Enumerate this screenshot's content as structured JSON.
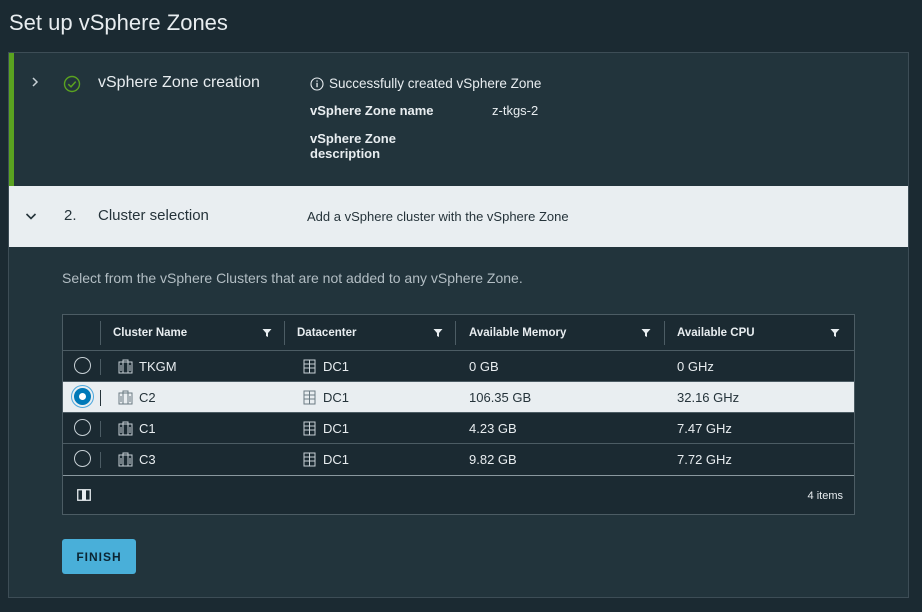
{
  "page": {
    "title": "Set up vSphere Zones"
  },
  "step1": {
    "title": "vSphere Zone creation",
    "status": "Successfully created vSphere Zone",
    "zone_name_label": "vSphere Zone name",
    "zone_name_value": "z-tkgs-2",
    "zone_desc_label_1": "vSphere Zone",
    "zone_desc_label_2": "description",
    "accent_color": "#5aa220"
  },
  "step2": {
    "number": "2.",
    "title": "Cluster selection",
    "description": "Add a vSphere cluster with the vSphere Zone",
    "instructions": "Select from the vSphere Clusters that are not added to any vSphere Zone."
  },
  "grid": {
    "columns": [
      "Cluster Name",
      "Datacenter",
      "Available Memory",
      "Available CPU"
    ],
    "rows": [
      {
        "cluster": "TKGM",
        "datacenter": "DC1",
        "memory": "0 GB",
        "cpu": "0 GHz",
        "selected": false
      },
      {
        "cluster": "C2",
        "datacenter": "DC1",
        "memory": "106.35 GB",
        "cpu": "32.16 GHz",
        "selected": true
      },
      {
        "cluster": "C1",
        "datacenter": "DC1",
        "memory": "4.23 GB",
        "cpu": "7.47 GHz",
        "selected": false
      },
      {
        "cluster": "C3",
        "datacenter": "DC1",
        "memory": "9.82 GB",
        "cpu": "7.72 GHz",
        "selected": false
      }
    ],
    "footer_count": "4 items"
  },
  "actions": {
    "finish_label": "FINISH"
  },
  "icons": {
    "step1_chevron": "chevron-right-icon",
    "step1_status": "check-circle-icon",
    "info": "info-icon",
    "step2_chevron": "chevron-down-icon",
    "filter": "filter-icon",
    "cluster": "cluster-icon",
    "datacenter": "datacenter-icon",
    "columns": "column-toggle-icon"
  }
}
